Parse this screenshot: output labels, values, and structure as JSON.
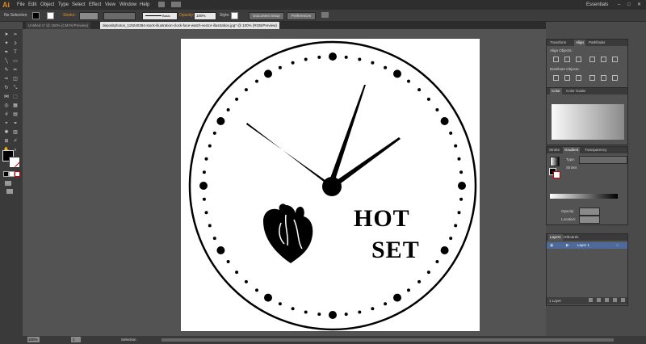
{
  "app": {
    "logo": "Ai",
    "essentials": "Essentials"
  },
  "menu": [
    "File",
    "Edit",
    "Object",
    "Type",
    "Select",
    "Effect",
    "View",
    "Window",
    "Help"
  ],
  "control": {
    "selection_label": "No Selection",
    "stroke_label": "Stroke:",
    "stroke_style": "Basic",
    "opacity_label": "Opacity:",
    "opacity_value": "100%",
    "style_label": "Style:",
    "doc_setup": "Document Setup",
    "preferences": "Preferences"
  },
  "tabs": [
    {
      "label": "Untitled-1* @ 150% (CMYK/Preview)"
    },
    {
      "label": "depositphotos_119240384-stock-illustration-clock-face-watch-vector-illustration.jpg* @ 100% (RGB/Preview)"
    }
  ],
  "panels": {
    "align": {
      "tabs": [
        "Transform",
        "Align",
        "Pathfinder"
      ],
      "align_objects": "Align Objects:",
      "distribute_objects": "Distribute Objects:"
    },
    "color": {
      "tabs": [
        "Color",
        "Color Guide"
      ]
    },
    "gradient": {
      "tabs": [
        "Stroke",
        "Gradient",
        "Transparency"
      ],
      "type_label": "Type:",
      "stroke_label": "Stroke:",
      "opacity_label": "Opacity:",
      "location_label": "Location:"
    },
    "layers": {
      "tabs": [
        "Layers",
        "Artboards"
      ],
      "layer_name": "Layer 1",
      "footer": "1 Layer"
    }
  },
  "artwork": {
    "text_line1": "HOT",
    "text_line2": "SET"
  },
  "status": {
    "zoom": "100%",
    "page": "1",
    "tool": "Selection"
  }
}
